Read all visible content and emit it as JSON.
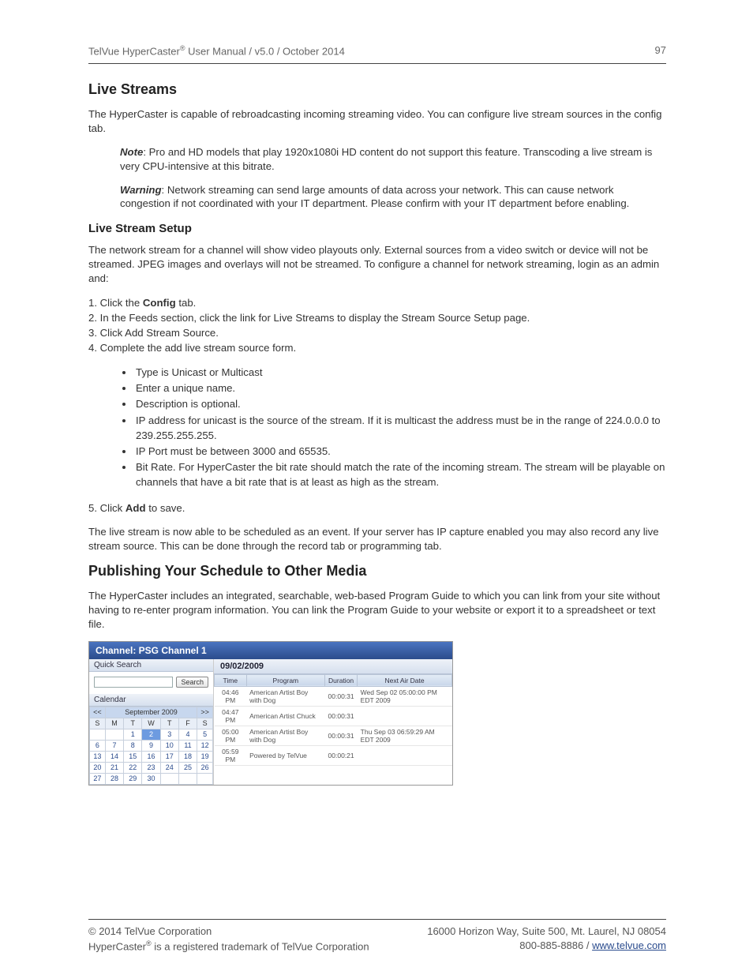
{
  "header": {
    "product": "TelVue HyperCaster",
    "reg": "®",
    "doc": " User Manual  / v5.0 / October 2014",
    "page": "97"
  },
  "s1": {
    "h": "Live Streams",
    "p1": "The HyperCaster is capable of rebroadcasting incoming streaming video. You can configure live stream sources in the config tab.",
    "note_lbl": "Note",
    "note": ": Pro and HD models that play 1920x1080i HD content do not support this feature. Transcoding a live stream is very CPU-intensive at this bitrate.",
    "warn_lbl": "Warning",
    "warn": ": Network streaming can send large amounts of data across your network. This can cause network congestion if not coordinated with your IT department. Please confirm with your IT department before enabling."
  },
  "s2": {
    "h": "Live Stream Setup",
    "p1": "The network stream for a channel will show video playouts only. External sources from a video switch or device will not be streamed. JPEG images and overlays will not be streamed.  To configure a channel for network streaming, login as an admin and:",
    "step1a": "1. Click the ",
    "step1b": "Config",
    "step1c": " tab.",
    "step2": "2. In the Feeds section, click the link for Live Streams to display the Stream Source Setup page.",
    "step3": "3. Click Add Stream Source.",
    "step4": "4. Complete the add live stream source form.",
    "b1": "Type is Unicast or Multicast",
    "b2": "Enter a unique name.",
    "b3": "Description is optional.",
    "b4": "IP address for unicast is the source of the stream. If it is multicast the address must be in the range of 224.0.0.0 to 239.255.255.255.",
    "b5": "IP Port must be between 3000 and 65535.",
    "b6": "Bit Rate. For HyperCaster the bit rate should match the rate of the incoming stream. The stream will be playable on channels that have a bit rate that is at least as high as the stream.",
    "step5a": "5. Click ",
    "step5b": "Add",
    "step5c": " to save.",
    "p2": "The live stream is now able to be scheduled as an event. If your server has IP capture enabled you may also record any live stream source. This can be done through the record tab or programming tab."
  },
  "s3": {
    "h": "Publishing Your Schedule to Other Media",
    "p1": "The HyperCaster includes an integrated, searchable, web-based Program Guide to which you can link from your site without having to re-enter program information. You can link the Program Guide to your website or export it to a spreadsheet or text file."
  },
  "fig": {
    "title": "Channel: PSG Channel 1",
    "quick_search": "Quick Search",
    "search_btn": "Search",
    "calendar": "Calendar",
    "month": "September 2009",
    "prev": "<<",
    "next": ">>",
    "dows": [
      "S",
      "M",
      "T",
      "W",
      "T",
      "F",
      "S"
    ],
    "weeks": [
      [
        "",
        "",
        "1",
        "2",
        "3",
        "4",
        "5"
      ],
      [
        "6",
        "7",
        "8",
        "9",
        "10",
        "11",
        "12"
      ],
      [
        "13",
        "14",
        "15",
        "16",
        "17",
        "18",
        "19"
      ],
      [
        "20",
        "21",
        "22",
        "23",
        "24",
        "25",
        "26"
      ],
      [
        "27",
        "28",
        "29",
        "30",
        "",
        "",
        ""
      ]
    ],
    "sel_day": "2",
    "date": "09/02/2009",
    "cols": [
      "Time",
      "Program",
      "Duration",
      "Next Air Date"
    ],
    "rows": [
      [
        "04:46 PM",
        "American Artist Boy with Dog",
        "00:00:31",
        "Wed Sep 02 05:00:00 PM EDT 2009"
      ],
      [
        "04:47 PM",
        "American Artist Chuck",
        "00:00:31",
        ""
      ],
      [
        "05:00 PM",
        "American Artist Boy with Dog",
        "00:00:31",
        "Thu Sep 03 06:59:29 AM EDT 2009"
      ],
      [
        "05:59 PM",
        "Powered by TelVue",
        "00:00:21",
        ""
      ]
    ]
  },
  "footer": {
    "l1a": "© 2014 TelVue Corporation",
    "l1b": "16000 Horizon Way, Suite 500, Mt. Laurel, NJ 08054",
    "l2a1": "HyperCaster",
    "l2a2": "®",
    "l2a3": " is a registered trademark of TelVue Corporation",
    "l2b1": "800-885-8886  / ",
    "l2b2": "www.telvue.com"
  }
}
